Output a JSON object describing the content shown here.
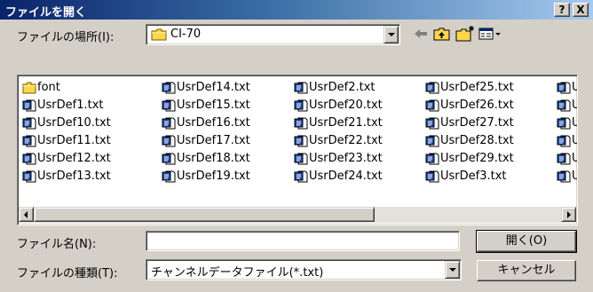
{
  "dialog": {
    "title": "ファイルを開く",
    "help_label": "?",
    "close_label": "X"
  },
  "location": {
    "label": "ファイルの場所(I):",
    "value": "CI-70"
  },
  "files": {
    "columns": [
      [
        {
          "name": "font",
          "type": "folder"
        },
        {
          "name": "UsrDef1.txt",
          "type": "txt"
        },
        {
          "name": "UsrDef10.txt",
          "type": "txt"
        },
        {
          "name": "UsrDef11.txt",
          "type": "txt"
        },
        {
          "name": "UsrDef12.txt",
          "type": "txt"
        },
        {
          "name": "UsrDef13.txt",
          "type": "txt"
        }
      ],
      [
        {
          "name": "UsrDef14.txt",
          "type": "txt"
        },
        {
          "name": "UsrDef15.txt",
          "type": "txt"
        },
        {
          "name": "UsrDef16.txt",
          "type": "txt"
        },
        {
          "name": "UsrDef17.txt",
          "type": "txt"
        },
        {
          "name": "UsrDef18.txt",
          "type": "txt"
        },
        {
          "name": "UsrDef19.txt",
          "type": "txt"
        }
      ],
      [
        {
          "name": "UsrDef2.txt",
          "type": "txt"
        },
        {
          "name": "UsrDef20.txt",
          "type": "txt"
        },
        {
          "name": "UsrDef21.txt",
          "type": "txt"
        },
        {
          "name": "UsrDef22.txt",
          "type": "txt"
        },
        {
          "name": "UsrDef23.txt",
          "type": "txt"
        },
        {
          "name": "UsrDef24.txt",
          "type": "txt"
        }
      ],
      [
        {
          "name": "UsrDef25.txt",
          "type": "txt"
        },
        {
          "name": "UsrDef26.txt",
          "type": "txt"
        },
        {
          "name": "UsrDef27.txt",
          "type": "txt"
        },
        {
          "name": "UsrDef28.txt",
          "type": "txt"
        },
        {
          "name": "UsrDef29.txt",
          "type": "txt"
        },
        {
          "name": "UsrDef3.txt",
          "type": "txt"
        }
      ],
      [
        {
          "name": "U",
          "type": "txt"
        },
        {
          "name": "U",
          "type": "txt"
        },
        {
          "name": "U",
          "type": "txt"
        },
        {
          "name": "U",
          "type": "txt"
        },
        {
          "name": "U",
          "type": "txt"
        },
        {
          "name": "U",
          "type": "txt"
        }
      ]
    ]
  },
  "filename": {
    "label": "ファイル名(N):",
    "value": ""
  },
  "filetype": {
    "label": "ファイルの種類(T):",
    "value": "チャンネルデータファイル(*.txt)"
  },
  "buttons": {
    "open_label": "開く(O)",
    "cancel_label": "キャンセル"
  },
  "icons": {
    "back": "back-arrow-icon",
    "up": "up-folder-icon",
    "new_folder": "new-folder-icon",
    "view_menu": "view-menu-icon",
    "folder": "folder-icon",
    "text_file": "text-file-icon"
  }
}
